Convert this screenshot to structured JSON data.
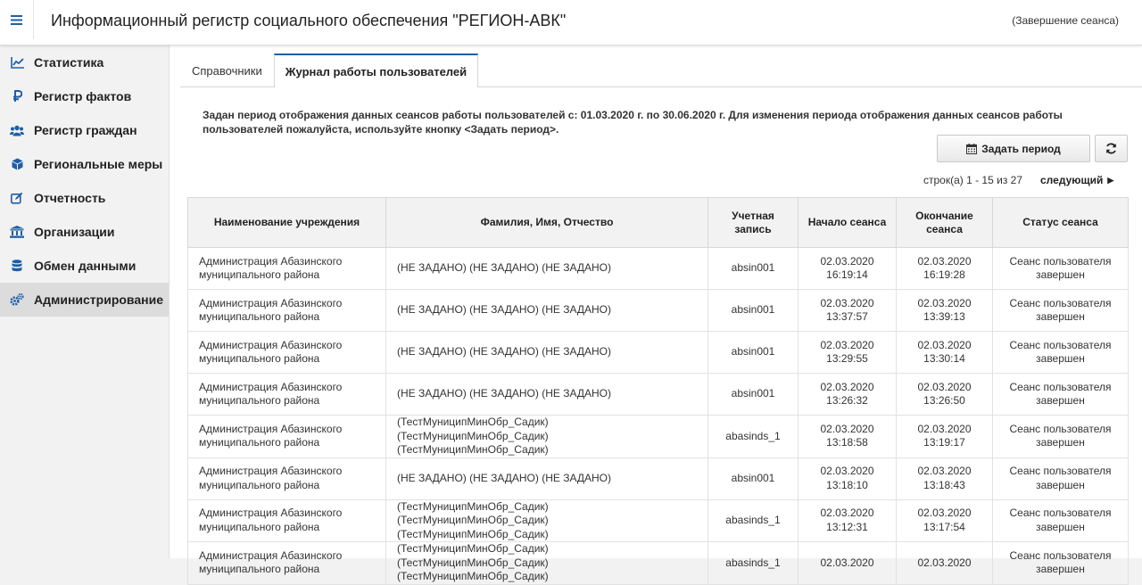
{
  "header": {
    "title": "Информационный регистр социального обеспечения \"РЕГИОН-АВК\"",
    "logout": "(Завершение сеанса)"
  },
  "sidebar": {
    "items": [
      {
        "label": "Статистика",
        "icon": "chart-line-icon"
      },
      {
        "label": "Регистр фактов",
        "icon": "ruble-icon"
      },
      {
        "label": "Регистр граждан",
        "icon": "users-icon"
      },
      {
        "label": "Региональные меры",
        "icon": "cube-icon"
      },
      {
        "label": "Отчетность",
        "icon": "edit-icon"
      },
      {
        "label": "Организации",
        "icon": "institution-icon"
      },
      {
        "label": "Обмен данными",
        "icon": "database-icon"
      },
      {
        "label": "Администрирование",
        "icon": "gears-icon"
      }
    ],
    "active_index": 7
  },
  "tabs": [
    {
      "label": "Справочники"
    },
    {
      "label": "Журнал работы пользователей"
    }
  ],
  "notice": "Задан период отображения данных сеансов работы пользователей с: 01.03.2020 г. по 30.06.2020 г. Для изменения периода отображения данных сеансов работы пользователей пожалуйста, используйте кнопку <Задать период>.",
  "buttons": {
    "set_period": "Задать период"
  },
  "pager": {
    "info": "строк(а) 1 - 15 из 27",
    "next": "следующий"
  },
  "table": {
    "columns": [
      "Наименование учреждения",
      "Фамилия, Имя, Отчество",
      "Учетная запись",
      "Начало сеанса",
      "Окончание сеанса",
      "Статус сеанса"
    ],
    "rows": [
      {
        "org": "Администрация Абазинского муниципального района",
        "fio": "(НЕ ЗАДАНО) (НЕ ЗАДАНО) (НЕ ЗАДАНО)",
        "login": "absin001",
        "start": "02.03.2020 16:19:14",
        "end": "02.03.2020 16:19:28",
        "status": "Сеанс пользователя завершен"
      },
      {
        "org": "Администрация Абазинского муниципального района",
        "fio": "(НЕ ЗАДАНО) (НЕ ЗАДАНО) (НЕ ЗАДАНО)",
        "login": "absin001",
        "start": "02.03.2020 13:37:57",
        "end": "02.03.2020 13:39:13",
        "status": "Сеанс пользователя завершен"
      },
      {
        "org": "Администрация Абазинского муниципального района",
        "fio": "(НЕ ЗАДАНО) (НЕ ЗАДАНО) (НЕ ЗАДАНО)",
        "login": "absin001",
        "start": "02.03.2020 13:29:55",
        "end": "02.03.2020 13:30:14",
        "status": "Сеанс пользователя завершен"
      },
      {
        "org": "Администрация Абазинского муниципального района",
        "fio": "(НЕ ЗАДАНО) (НЕ ЗАДАНО) (НЕ ЗАДАНО)",
        "login": "absin001",
        "start": "02.03.2020 13:26:32",
        "end": "02.03.2020 13:26:50",
        "status": "Сеанс пользователя завершен"
      },
      {
        "org": "Администрация Абазинского муниципального района",
        "fio": "(ТестМуниципМинОбр_Садик) (ТестМуниципМинОбр_Садик) (ТестМуниципМинОбр_Садик)",
        "login": "abasinds_1",
        "start": "02.03.2020 13:18:58",
        "end": "02.03.2020 13:19:17",
        "status": "Сеанс пользователя завершен"
      },
      {
        "org": "Администрация Абазинского муниципального района",
        "fio": "(НЕ ЗАДАНО) (НЕ ЗАДАНО) (НЕ ЗАДАНО)",
        "login": "absin001",
        "start": "02.03.2020 13:18:10",
        "end": "02.03.2020 13:18:43",
        "status": "Сеанс пользователя завершен"
      },
      {
        "org": "Администрация Абазинского муниципального района",
        "fio": "(ТестМуниципМинОбр_Садик) (ТестМуниципМинОбр_Садик) (ТестМуниципМинОбр_Садик)",
        "login": "abasinds_1",
        "start": "02.03.2020 13:12:31",
        "end": "02.03.2020 13:17:54",
        "status": "Сеанс пользователя завершен"
      },
      {
        "org": "Администрация Абазинского муниципального района",
        "fio": "(ТестМуниципМинОбр_Садик) (ТестМуниципМинОбр_Садик) (ТестМуниципМинОбр_Садик)",
        "login": "abasinds_1",
        "start": "02.03.2020",
        "end": "02.03.2020",
        "status": "Сеанс пользователя завершен"
      }
    ]
  }
}
